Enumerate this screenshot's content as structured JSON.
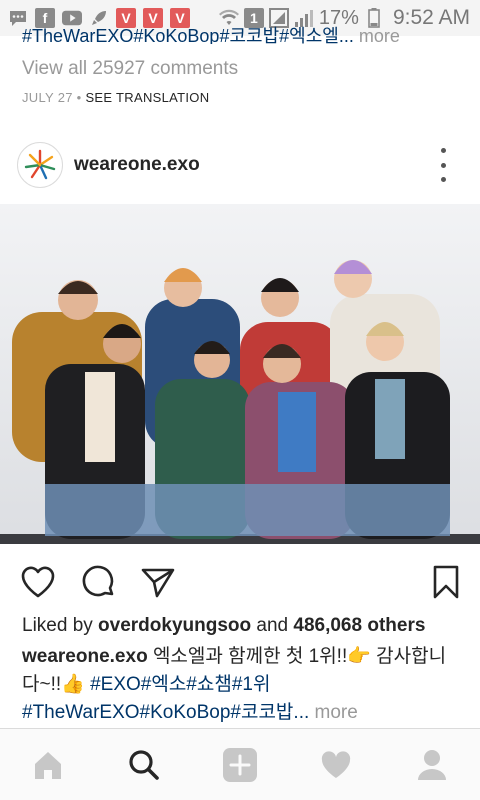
{
  "status_bar": {
    "battery_percent": "17%",
    "time": "9:52 AM",
    "notification_icons": [
      "message-icon",
      "facebook-icon",
      "youtube-icon",
      "rocket-icon",
      "v-app-icon",
      "v-app-icon",
      "v-app-icon"
    ],
    "box_label": "1"
  },
  "previous_post": {
    "caption_tail": "#TheWarEXO#KoKoBop#코코밥#엑소엘...",
    "more_label": " more",
    "view_all_comments": "View all 25927 comments",
    "date": "JULY 27",
    "date_separator": " • ",
    "see_translation": "SEE TRANSLATION"
  },
  "post": {
    "username": "weareone.exo",
    "liked_by_prefix": "Liked by ",
    "liked_by_user": "overdokyungsoo",
    "liked_by_and": " and ",
    "likes_count": "486,068 others",
    "caption_user": "weareone.exo",
    "caption_text": " 엑소엘과 함께한 첫 1위!!👉 감사합니다~!!👍 ",
    "hashtags_line1": "#EXO#엑소#쇼챔#1위",
    "hashtags_line2": "#TheWarEXO#KoKoBop#코코밥...",
    "more_label": " more"
  },
  "actions": {
    "like": "heart-icon",
    "comment": "comment-icon",
    "share": "direct-share-icon",
    "save": "bookmark-icon"
  },
  "bottom_nav": [
    "home-icon",
    "search-icon",
    "add-post-icon",
    "activity-heart-icon",
    "profile-icon"
  ],
  "colors": {
    "hashtag": "#003569",
    "muted": "#999999",
    "text": "#262626",
    "nav_background": "#fafafa"
  }
}
